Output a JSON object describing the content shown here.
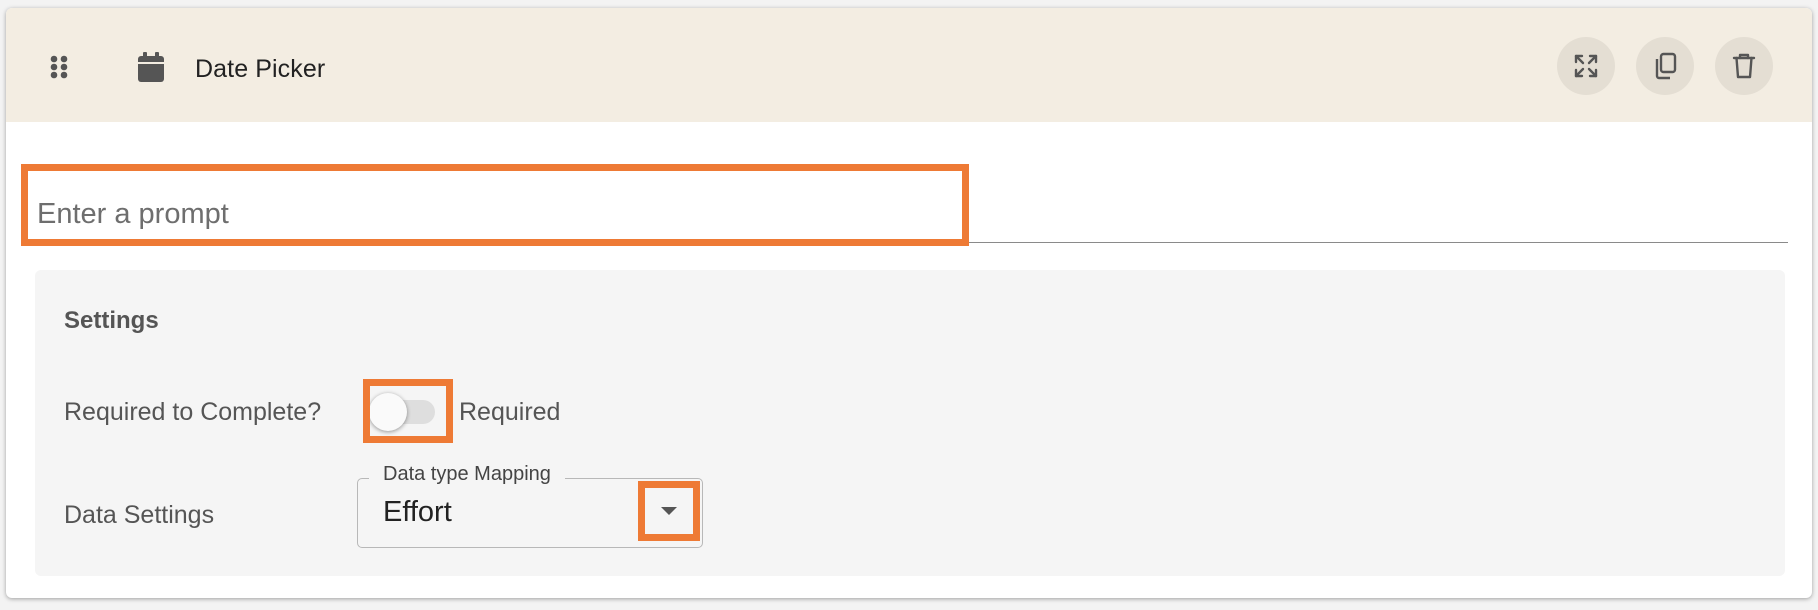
{
  "header": {
    "title": "Date Picker",
    "icons": {
      "drag": "drag-handle-icon",
      "calendar": "calendar-icon",
      "expand": "expand-icon",
      "duplicate": "duplicate-icon",
      "delete": "trash-icon"
    }
  },
  "prompt": {
    "placeholder": "Enter a prompt",
    "value": ""
  },
  "settings": {
    "title": "Settings",
    "required": {
      "label": "Required to Complete?",
      "toggle_label": "Required",
      "checked": false
    },
    "data": {
      "label": "Data Settings",
      "mapping_legend": "Data type Mapping",
      "mapping_value": "Effort"
    }
  },
  "colors": {
    "header_bg": "#f3ede2",
    "highlight": "#ee7a35",
    "settings_bg": "#f5f5f5",
    "icon_btn_bg": "#e4ded3"
  }
}
